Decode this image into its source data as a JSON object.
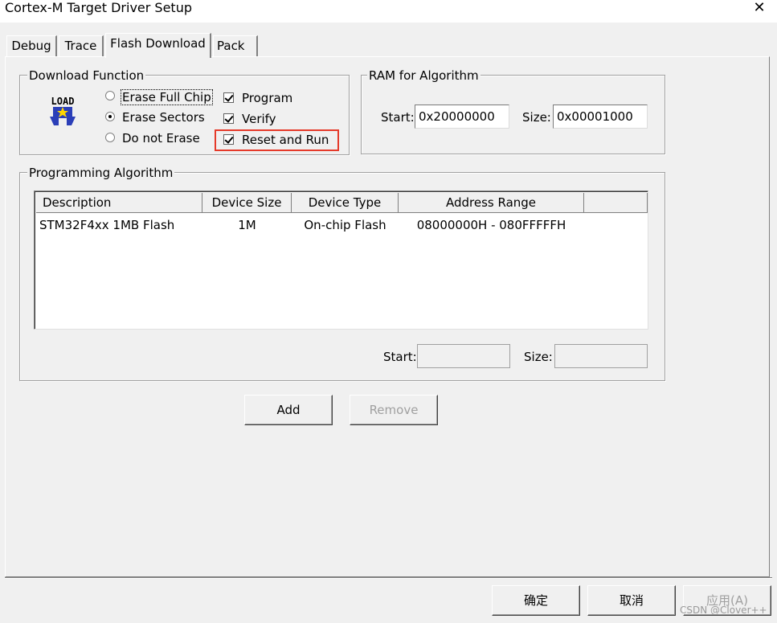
{
  "window": {
    "title": "Cortex-M Target Driver Setup",
    "close_glyph": "✕"
  },
  "tabs": [
    {
      "label": "Debug",
      "active": false
    },
    {
      "label": "Trace",
      "active": false
    },
    {
      "label": "Flash Download",
      "active": true
    },
    {
      "label": "Pack",
      "active": false
    }
  ],
  "download_function": {
    "group_label": "Download Function",
    "load_icon_text": "LOAD",
    "options": [
      {
        "label": "Erase Full Chip",
        "checked": false
      },
      {
        "label": "Erase Sectors",
        "checked": true
      },
      {
        "label": "Do not Erase",
        "checked": false
      }
    ],
    "checks": [
      {
        "label": "Program",
        "checked": true
      },
      {
        "label": "Verify",
        "checked": true
      },
      {
        "label": "Reset and Run",
        "checked": true,
        "highlighted": true
      }
    ],
    "highlight_color": "#e53a2a"
  },
  "ram_algorithm": {
    "group_label": "RAM for Algorithm",
    "start_label": "Start:",
    "start_value": "0x20000000",
    "size_label": "Size:",
    "size_value": "0x00001000"
  },
  "programming_algorithm": {
    "group_label": "Programming Algorithm",
    "columns": [
      "Description",
      "Device Size",
      "Device Type",
      "Address Range"
    ],
    "rows": [
      [
        "STM32F4xx 1MB Flash",
        "1M",
        "On-chip Flash",
        "08000000H - 080FFFFFH"
      ]
    ],
    "start_label": "Start:",
    "start_value": "",
    "size_label": "Size:",
    "size_value": ""
  },
  "buttons": {
    "add": "Add",
    "remove": "Remove"
  },
  "footer": {
    "ok": "确定",
    "cancel": "取消",
    "apply": "应用(A)"
  },
  "watermark": "CSDN @Clover++"
}
